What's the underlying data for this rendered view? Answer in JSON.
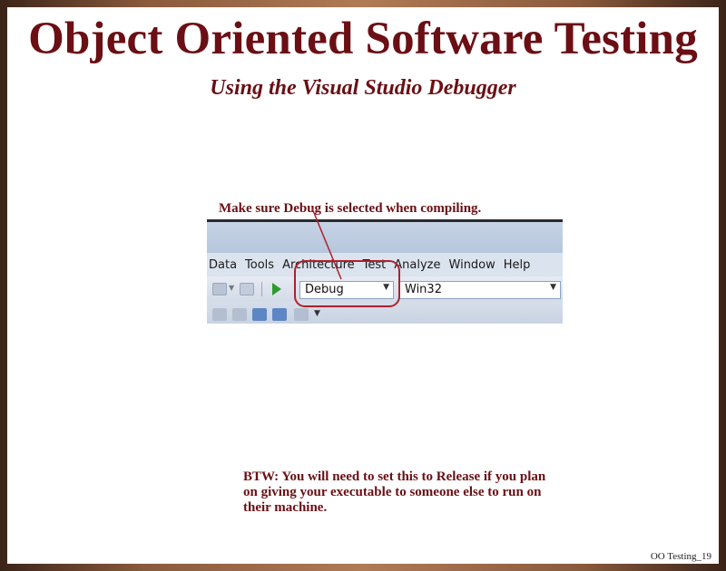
{
  "slide": {
    "title": "Object Oriented Software Testing",
    "subtitle": "Using the Visual Studio Debugger",
    "callout": "Make sure Debug is selected when compiling.",
    "note": "BTW: You will need to set this to Release if you plan on giving your executable to someone else to run on their machine.",
    "footer": "OO Testing_19"
  },
  "menubar": {
    "items": [
      "Data",
      "Tools",
      "Architecture",
      "Test",
      "Analyze",
      "Window",
      "Help"
    ]
  },
  "toolbar": {
    "config_value": "Debug",
    "platform_value": "Win32"
  },
  "colors": {
    "title": "#6b0f14",
    "highlight": "#b0202a"
  }
}
